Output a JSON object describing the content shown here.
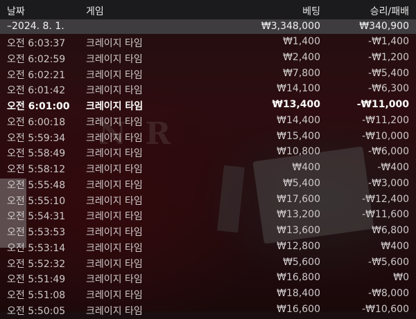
{
  "header": {
    "date_label": "날짜",
    "game_label": "게임",
    "bet_label": "베팅",
    "result_label": "승리/패배"
  },
  "summary": {
    "date": "–2024. 8. 1.",
    "bet": "₩3,348,000",
    "result": "₩340,900"
  },
  "rows": [
    {
      "time": "오전 6:03:37",
      "game": "크레이지 타임",
      "bet": "₩1,400",
      "result": "-₩1,400"
    },
    {
      "time": "오전 6:02:59",
      "game": "크레이지 타임",
      "bet": "₩2,400",
      "result": "-₩1,200"
    },
    {
      "time": "오전 6:02:21",
      "game": "크레이지 타임",
      "bet": "₩7,800",
      "result": "-₩5,400"
    },
    {
      "time": "오전 6:01:42",
      "game": "크레이지 타임",
      "bet": "₩14,100",
      "result": "-₩6,300"
    },
    {
      "time": "오전 6:01:00",
      "game": "크레이지 타임",
      "bet": "₩13,400",
      "result": "-₩11,000"
    },
    {
      "time": "오전 6:00:18",
      "game": "크레이지 타임",
      "bet": "₩14,400",
      "result": "-₩11,200"
    },
    {
      "time": "오전 5:59:34",
      "game": "크레이지 타임",
      "bet": "₩15,400",
      "result": "-₩10,000"
    },
    {
      "time": "오전 5:58:49",
      "game": "크레이지 타임",
      "bet": "₩10,800",
      "result": "-₩6,000"
    },
    {
      "time": "오전 5:58:12",
      "game": "크레이지 타임",
      "bet": "₩400",
      "result": "-₩400"
    },
    {
      "time": "오전 5:55:48",
      "game": "크레이지 타임",
      "bet": "₩5,400",
      "result": "-₩3,000"
    },
    {
      "time": "오전 5:55:10",
      "game": "크레이지 타임",
      "bet": "₩17,600",
      "result": "-₩12,400"
    },
    {
      "time": "오전 5:54:31",
      "game": "크레이지 타임",
      "bet": "₩13,200",
      "result": "-₩11,600"
    },
    {
      "time": "오전 5:53:53",
      "game": "크레이지 타임",
      "bet": "₩13,600",
      "result": "₩6,800"
    },
    {
      "time": "오전 5:53:14",
      "game": "크레이지 타임",
      "bet": "₩12,800",
      "result": "₩400"
    },
    {
      "time": "오전 5:52:32",
      "game": "크레이지 타임",
      "bet": "₩5,600",
      "result": "-₩5,600"
    },
    {
      "time": "오전 5:51:49",
      "game": "크레이지 타임",
      "bet": "₩16,800",
      "result": "₩0"
    },
    {
      "time": "오전 5:51:08",
      "game": "크레이지 타임",
      "bet": "₩18,400",
      "result": "-₩8,000"
    },
    {
      "time": "오전 5:50:05",
      "game": "크레이지 타임",
      "bet": "₩16,600",
      "result": "-₩10,600"
    }
  ]
}
